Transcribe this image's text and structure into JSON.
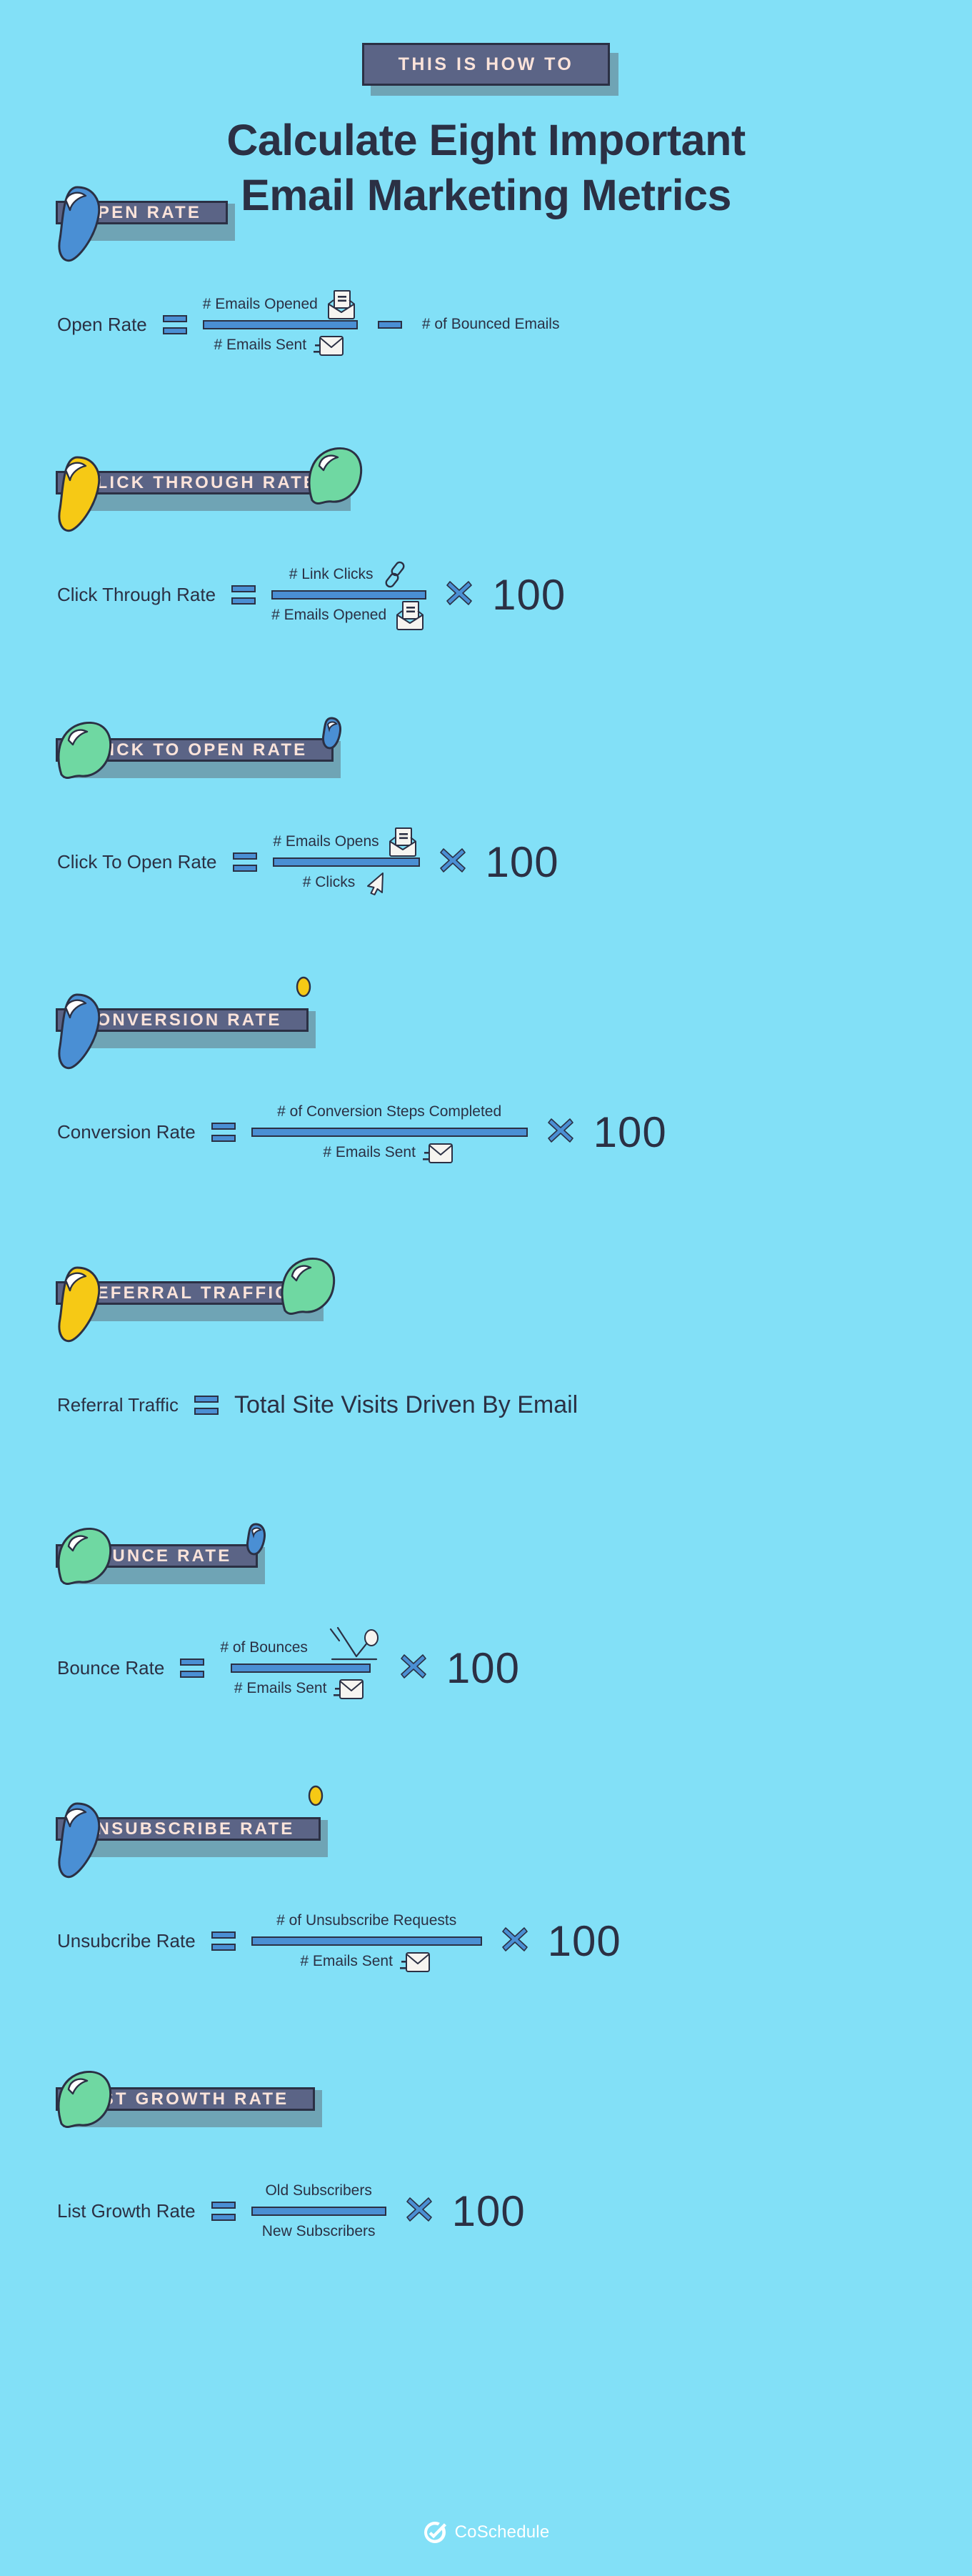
{
  "theme": {
    "background": "#82e0f7",
    "banner_fill": "#5b6486",
    "banner_text": "#fbe3da",
    "banner_shadow": "#6fa4b5",
    "ink": "#2b3044",
    "accent_blue": "#4a8fd4",
    "leaf_green": "#6fd8a2",
    "drop_blue": "#4a8fd4",
    "drop_yellow": "#f6c915",
    "paper": "#f6f4f0"
  },
  "header": {
    "eyebrow": "THIS IS HOW TO",
    "title_line1": "Calculate Eight Important",
    "title_line2": "Email Marketing Metrics"
  },
  "sections": [
    {
      "banner": "OPEN RATE",
      "label": "Open Rate",
      "numerator": "# Emails Opened",
      "numerator_icon": "open-envelope-icon",
      "denominator": "# Emails Sent",
      "denominator_icon": "closed-envelope-icon",
      "operator": "minus",
      "tail": "# of Bounced Emails",
      "decorations": [
        {
          "type": "drop",
          "color": "blue",
          "side": "left"
        }
      ]
    },
    {
      "banner": "CLICK THROUGH RATE",
      "label": "Click Through Rate",
      "numerator": "# Link Clicks",
      "numerator_icon": "link-icon",
      "denominator": "# Emails Opened",
      "denominator_icon": "open-envelope-icon",
      "operator": "times",
      "tail": "100",
      "decorations": [
        {
          "type": "drop",
          "color": "yellow-big",
          "side": "left"
        },
        {
          "type": "leaf",
          "color": "green",
          "side": "right"
        }
      ]
    },
    {
      "banner": "CLICK TO OPEN RATE",
      "label": "Click To Open Rate",
      "numerator": "# Emails Opens",
      "numerator_icon": "open-envelope-icon",
      "denominator": "# Clicks",
      "denominator_icon": "cursor-icon",
      "operator": "times",
      "tail": "100",
      "decorations": [
        {
          "type": "leaf",
          "color": "green",
          "side": "left"
        },
        {
          "type": "drop-small",
          "color": "blue",
          "side": "right"
        }
      ]
    },
    {
      "banner": "CONVERSION RATE",
      "label": "Conversion Rate",
      "numerator": "# of Conversion Steps Completed",
      "numerator_icon": "",
      "denominator": "# Emails Sent",
      "denominator_icon": "closed-envelope-icon",
      "operator": "times",
      "tail": "100",
      "decorations": [
        {
          "type": "drop",
          "color": "blue",
          "side": "left"
        },
        {
          "type": "dot",
          "color": "yellow",
          "side": "right"
        }
      ]
    },
    {
      "banner": "REFERRAL TRAFFIC",
      "label": "Referral Traffic",
      "plain_value": "Total Site Visits Driven By Email",
      "operator": "none",
      "decorations": [
        {
          "type": "drop",
          "color": "yellow-big",
          "side": "left"
        },
        {
          "type": "leaf",
          "color": "green",
          "side": "right"
        }
      ]
    },
    {
      "banner": "BOUNCE RATE",
      "label": "Bounce Rate",
      "numerator": "# of Bounces",
      "numerator_icon": "bouncing-ball-icon",
      "denominator": "# Emails Sent",
      "denominator_icon": "closed-envelope-icon",
      "operator": "times",
      "tail": "100",
      "decorations": [
        {
          "type": "leaf",
          "color": "green",
          "side": "left"
        },
        {
          "type": "drop-small",
          "color": "blue",
          "side": "right"
        }
      ]
    },
    {
      "banner": "UNSUBSCRIBE RATE",
      "label": "Unsubcribe Rate",
      "numerator": "# of Unsubscribe Requests",
      "numerator_icon": "",
      "denominator": "# Emails Sent",
      "denominator_icon": "closed-envelope-icon",
      "operator": "times",
      "tail": "100",
      "decorations": [
        {
          "type": "drop",
          "color": "blue",
          "side": "left"
        },
        {
          "type": "dot",
          "color": "yellow",
          "side": "right"
        }
      ]
    },
    {
      "banner": "LIST GROWTH RATE",
      "label": "List Growth Rate",
      "numerator": "Old Subscribers",
      "numerator_icon": "",
      "denominator": "New Subscribers",
      "denominator_icon": "",
      "operator": "times",
      "tail": "100",
      "decorations": [
        {
          "type": "leaf",
          "color": "green",
          "side": "left"
        }
      ]
    }
  ],
  "footer": {
    "brand": "CoSchedule",
    "logo_icon": "check-circle-icon"
  }
}
